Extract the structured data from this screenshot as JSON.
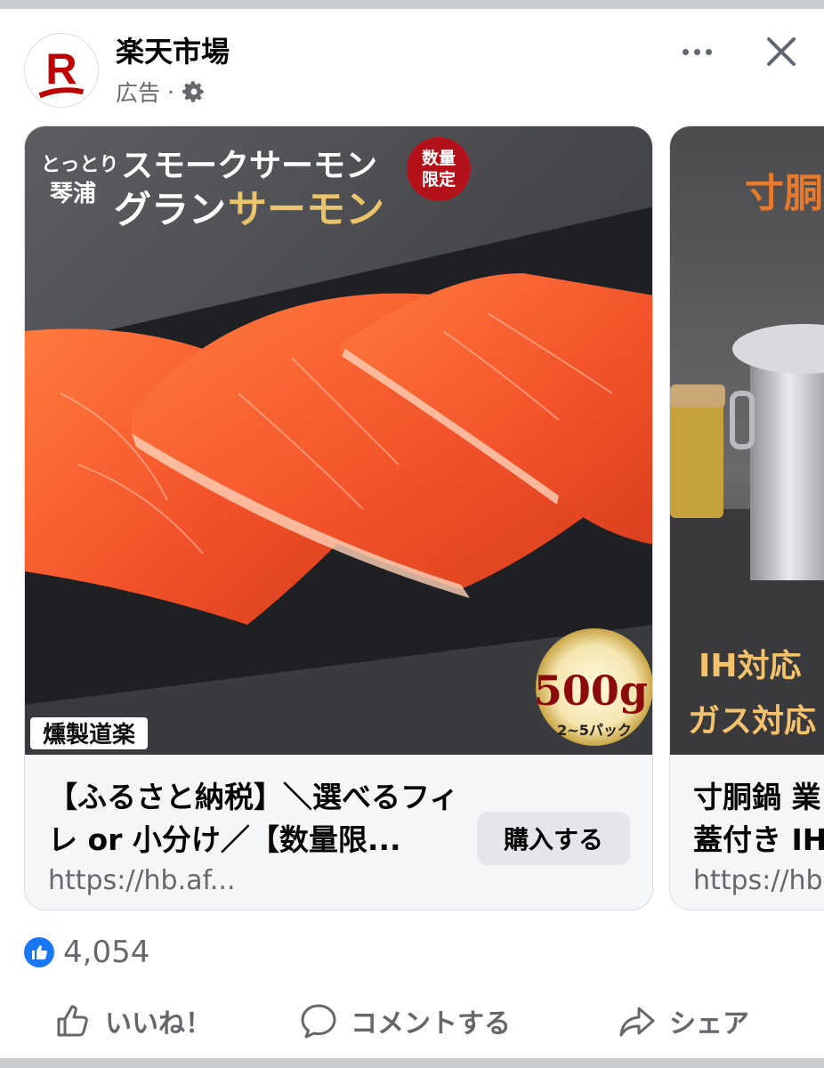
{
  "post": {
    "page_name": "楽天市場",
    "sponsored_label": "広告",
    "separator": "·",
    "avatar_letter": "R"
  },
  "carousel": [
    {
      "image_text": {
        "brand_small": "とっとり琴浦",
        "headline_1": "スモークサーモン",
        "headline_2a": "グラン",
        "headline_2b": "サーモン",
        "badge": "数量限定",
        "weight": "500g",
        "packs": "2~5パック",
        "maker": "燻製道楽"
      },
      "title": "【ふるさと納税】＼選べるフィレ or 小分け／【数量限...",
      "url": "https://hb.af...",
      "cta": "購入する"
    },
    {
      "image_text": {
        "headline": "寸胴",
        "ih": "IH対応",
        "gas": "ガス対応"
      },
      "title_line1": "寸胴鍋 業",
      "title_line2": "蓋付き IH",
      "url": "https://hb"
    }
  ],
  "reactions": {
    "count": "4,054"
  },
  "actions": {
    "like": "いいね！",
    "comment": "コメントする",
    "share": "シェア"
  },
  "colors": {
    "facebook_blue": "#1877f2",
    "rakuten_red": "#bf0000",
    "secondary_text": "#65676b",
    "button_gray": "#e4e6eb"
  },
  "icons": [
    "rakuten-logo",
    "gear-icon",
    "more-icon",
    "close-icon",
    "like-icon",
    "thumbs-up-icon",
    "comment-icon",
    "share-icon"
  ]
}
